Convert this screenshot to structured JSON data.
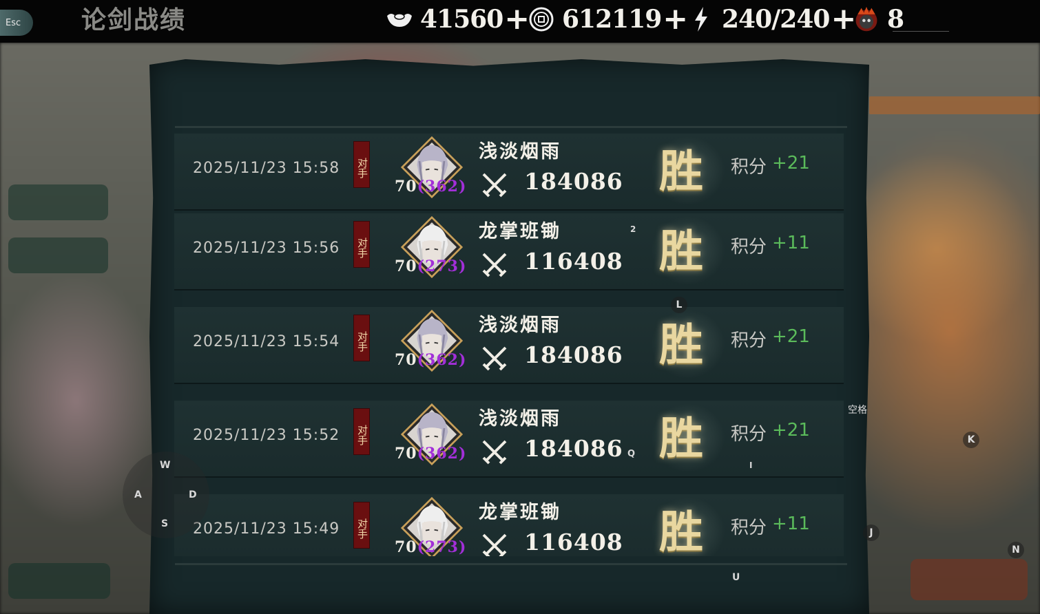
{
  "header": {
    "esc_label": "Esc",
    "title": "论剑战绩",
    "resources": [
      {
        "icon": "silver-ingot-icon",
        "value": "41560",
        "plus": "+"
      },
      {
        "icon": "copper-coin-icon",
        "value": "612119",
        "plus": "+"
      },
      {
        "icon": "lightning-energy-icon",
        "value": "240/240",
        "plus": "+"
      },
      {
        "icon": "demon-mask-token-icon",
        "value": "8"
      }
    ]
  },
  "records": [
    {
      "date": "2025/11/23 15:58",
      "tag": "对手",
      "avatar": "silver-hair-portrait",
      "level": "70",
      "rank": "(362)",
      "name": "浅淡烟雨",
      "power": "184086",
      "result": "胜",
      "score_label": "积分",
      "score_delta": "+21"
    },
    {
      "date": "2025/11/23 15:56",
      "tag": "对手",
      "avatar": "white-hair-portrait",
      "level": "70",
      "rank": "(273)",
      "name": "龙掌班锄",
      "power": "116408",
      "result": "胜",
      "score_label": "积分",
      "score_delta": "+11"
    },
    {
      "date": "2025/11/23 15:54",
      "tag": "对手",
      "avatar": "silver-hair-portrait",
      "level": "70",
      "rank": "(362)",
      "name": "浅淡烟雨",
      "power": "184086",
      "result": "胜",
      "score_label": "积分",
      "score_delta": "+21"
    },
    {
      "date": "2025/11/23 15:52",
      "tag": "对手",
      "avatar": "silver-hair-portrait",
      "level": "70",
      "rank": "(362)",
      "name": "浅淡烟雨",
      "power": "184086",
      "result": "胜",
      "score_label": "积分",
      "score_delta": "+21"
    },
    {
      "date": "2025/11/23 15:49",
      "tag": "对手",
      "avatar": "white-hair-portrait",
      "level": "70",
      "rank": "(273)",
      "name": "龙掌班锄",
      "power": "116408",
      "result": "胜",
      "score_label": "积分",
      "score_delta": "+11"
    }
  ],
  "key_hints": {
    "w": "W",
    "a": "A",
    "s": "S",
    "d": "D",
    "num2": "2",
    "l": "L",
    "q": "Q",
    "i": "I",
    "space": "空格",
    "k": "K",
    "j": "J",
    "n": "N",
    "u": "U"
  },
  "colors": {
    "win": "#e9d7a0",
    "score_positive": "#5bbb5b",
    "rank": "#a22fd8",
    "opponent_tag": "#6a0f10"
  }
}
